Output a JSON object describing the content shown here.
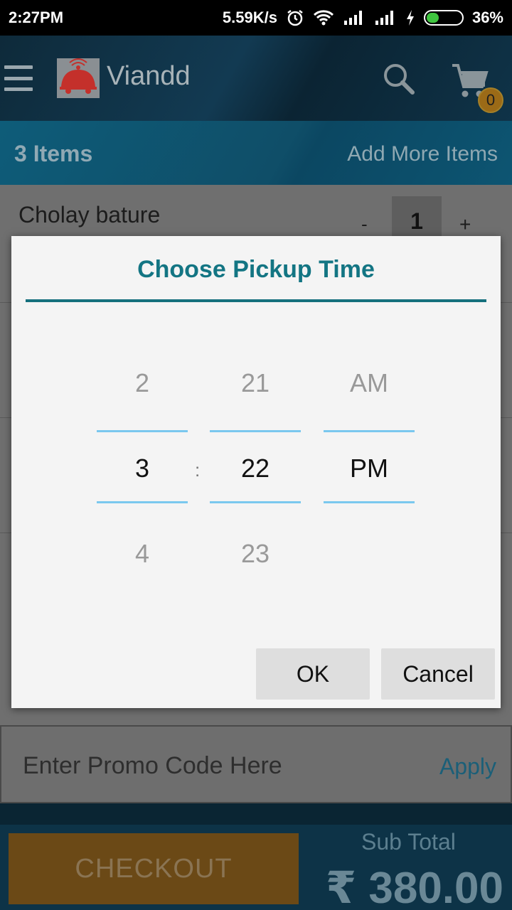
{
  "status_bar": {
    "time": "2:27PM",
    "network_speed": "5.59K/s",
    "battery": "36%",
    "battery_level": 0.36
  },
  "app_bar": {
    "title": "Viandd",
    "cart_count": "0"
  },
  "items_bar": {
    "count_label": "3 Items",
    "add_more_label": "Add More Items"
  },
  "cart": {
    "items": [
      {
        "name": "Cholay bature",
        "quantity": "1",
        "minus": "-",
        "plus": "+"
      }
    ]
  },
  "promo": {
    "placeholder": "Enter Promo Code Here",
    "apply_label": "Apply"
  },
  "footer": {
    "checkout_label": "CHECKOUT",
    "subtotal_label": "Sub Total",
    "subtotal_value": "₹ 380.00"
  },
  "dialog": {
    "title": "Choose Pickup Time",
    "hour": {
      "prev": "2",
      "selected": "3",
      "next": "4"
    },
    "separator": ":",
    "minute": {
      "prev": "21",
      "selected": "22",
      "next": "23"
    },
    "ampm": {
      "prev": "AM",
      "selected": "PM"
    },
    "ok_label": "OK",
    "cancel_label": "Cancel"
  },
  "colors": {
    "accent": "#137583",
    "picker_line": "#7ac8ee",
    "checkout": "#6b4916",
    "app_bar": "#0e2a3a"
  }
}
